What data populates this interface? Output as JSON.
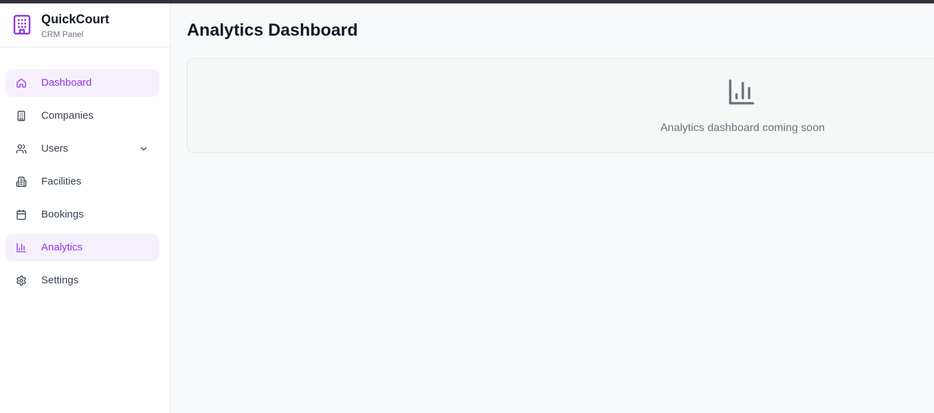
{
  "brand": {
    "title": "QuickCourt",
    "subtitle": "CRM Panel",
    "logo_icon": "building-icon",
    "accent_color": "#9333ea"
  },
  "sidebar": {
    "items": [
      {
        "label": "Dashboard",
        "icon": "home-icon",
        "active": true
      },
      {
        "label": "Companies",
        "icon": "building-icon",
        "active": false
      },
      {
        "label": "Users",
        "icon": "users-icon",
        "active": false,
        "expandable": true
      },
      {
        "label": "Facilities",
        "icon": "facility-icon",
        "active": false
      },
      {
        "label": "Bookings",
        "icon": "calendar-icon",
        "active": false
      },
      {
        "label": "Analytics",
        "icon": "bar-chart-icon",
        "active": true
      },
      {
        "label": "Settings",
        "icon": "gear-icon",
        "active": false
      }
    ]
  },
  "main": {
    "title": "Analytics Dashboard",
    "placeholder": {
      "icon": "bar-chart-icon",
      "text": "Analytics dashboard coming soon"
    }
  }
}
